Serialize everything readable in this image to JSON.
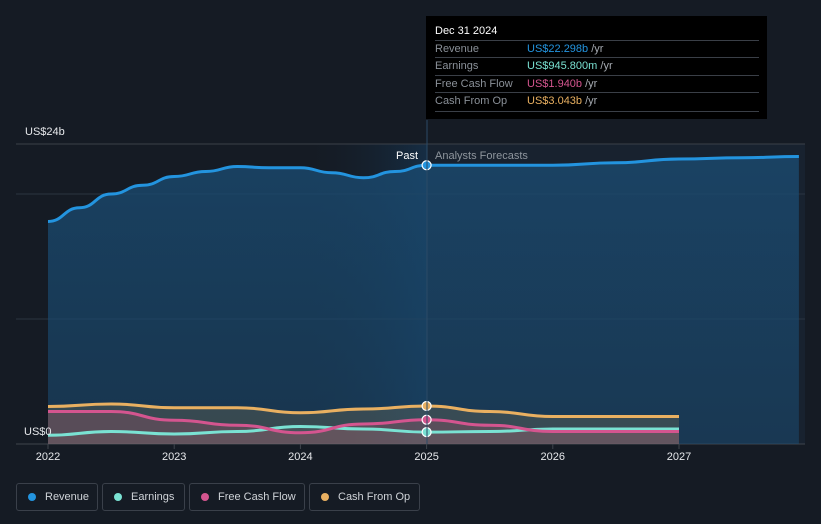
{
  "tooltip": {
    "date": "Dec 31 2024",
    "rows": [
      {
        "label": "Revenue",
        "value": "US$22.298b",
        "unit": "/yr",
        "color": "#2394df"
      },
      {
        "label": "Earnings",
        "value": "US$945.800m",
        "unit": "/yr",
        "color": "#7ae2d3"
      },
      {
        "label": "Free Cash Flow",
        "value": "US$1.940b",
        "unit": "/yr",
        "color": "#d4558f"
      },
      {
        "label": "Cash From Op",
        "value": "US$3.043b",
        "unit": "/yr",
        "color": "#e9b061"
      }
    ]
  },
  "chart_data": {
    "type": "area",
    "title": "",
    "xlabel": "",
    "ylabel": "",
    "ylim": [
      0,
      24
    ],
    "xlim": [
      2021.75,
      2027.95
    ],
    "y_tick_labels": [
      "US$0",
      "US$24b"
    ],
    "x_tick_labels": [
      "2022",
      "2023",
      "2024",
      "2025",
      "2026",
      "2027"
    ],
    "x_ticks": [
      2022,
      2023,
      2024,
      2025,
      2026,
      2027
    ],
    "segments": {
      "past_label": "Past",
      "forecast_label": "Analysts Forecasts",
      "divider_x": 2025.0
    },
    "grid": true,
    "legend_position": "bottom-left",
    "series": [
      {
        "name": "Revenue",
        "color": "#2394df",
        "unit": "US$b",
        "x": [
          2022.0,
          2022.25,
          2022.5,
          2022.75,
          2023.0,
          2023.25,
          2023.5,
          2023.75,
          2024.0,
          2024.25,
          2024.5,
          2024.75,
          2025.0,
          2025.5,
          2026.0,
          2026.5,
          2027.0,
          2027.5,
          2027.95
        ],
        "values": [
          17.8,
          18.9,
          20.0,
          20.7,
          21.4,
          21.8,
          22.2,
          22.1,
          22.1,
          21.7,
          21.3,
          21.8,
          22.3,
          22.3,
          22.3,
          22.5,
          22.8,
          22.9,
          23.0
        ]
      },
      {
        "name": "Earnings",
        "color": "#7ae2d3",
        "unit": "US$b",
        "x": [
          2022.0,
          2022.5,
          2023.0,
          2023.5,
          2024.0,
          2024.5,
          2025.0,
          2025.5,
          2026.0,
          2026.5,
          2027.0
        ],
        "values": [
          0.7,
          1.0,
          0.8,
          1.0,
          1.4,
          1.2,
          0.95,
          1.0,
          1.2,
          1.2,
          1.2
        ]
      },
      {
        "name": "Free Cash Flow",
        "color": "#d4558f",
        "unit": "US$b",
        "x": [
          2022.0,
          2022.5,
          2023.0,
          2023.5,
          2024.0,
          2024.5,
          2025.0,
          2025.5,
          2026.0,
          2026.5,
          2027.0
        ],
        "values": [
          2.6,
          2.6,
          1.9,
          1.5,
          0.9,
          1.6,
          1.94,
          1.5,
          1.0,
          1.0,
          1.0
        ]
      },
      {
        "name": "Cash From Op",
        "color": "#e9b061",
        "unit": "US$b",
        "x": [
          2022.0,
          2022.5,
          2023.0,
          2023.5,
          2024.0,
          2024.5,
          2025.0,
          2025.5,
          2026.0,
          2026.5,
          2027.0
        ],
        "values": [
          3.0,
          3.2,
          2.9,
          2.9,
          2.5,
          2.8,
          3.04,
          2.6,
          2.2,
          2.2,
          2.2
        ]
      }
    ],
    "highlight_x": 2025.0
  },
  "legend": [
    {
      "label": "Revenue",
      "color": "#2394df"
    },
    {
      "label": "Earnings",
      "color": "#7ae2d3"
    },
    {
      "label": "Free Cash Flow",
      "color": "#d4558f"
    },
    {
      "label": "Cash From Op",
      "color": "#e9b061"
    }
  ]
}
